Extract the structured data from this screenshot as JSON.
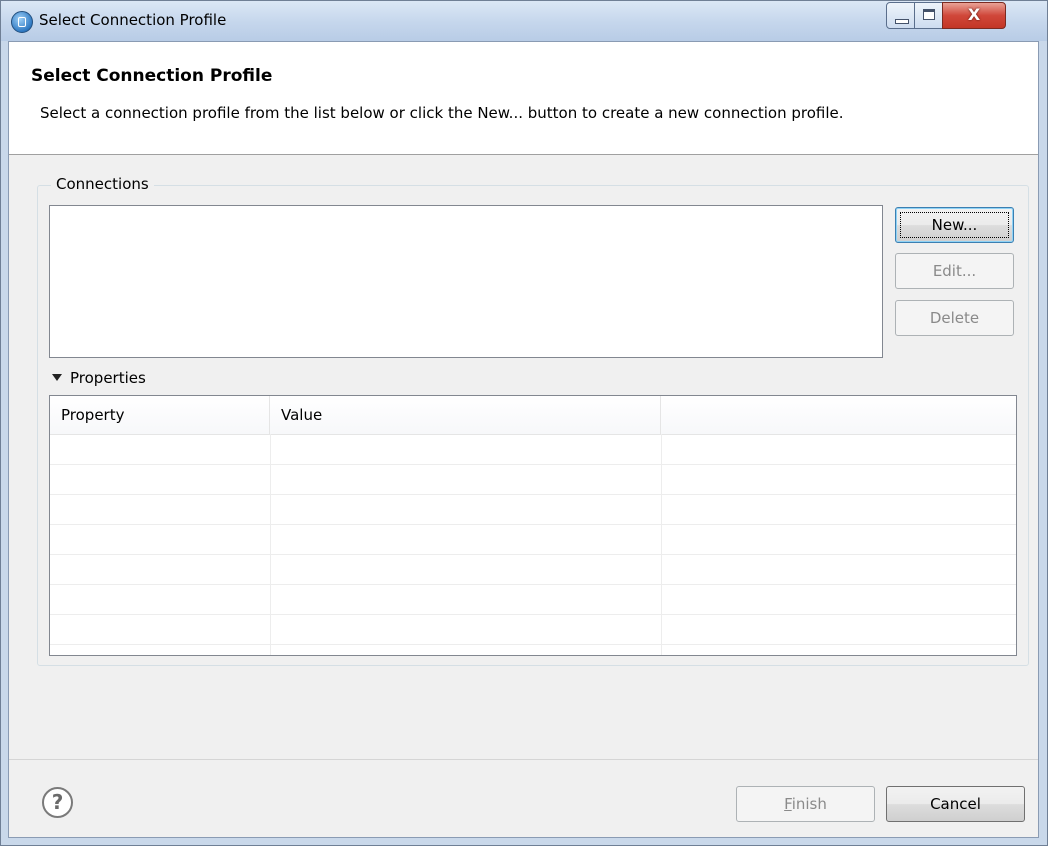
{
  "window": {
    "title": "Select Connection Profile",
    "controls": {
      "minimize": "minimize",
      "maximize": "maximize",
      "close": "X"
    }
  },
  "header": {
    "title": "Select Connection Profile",
    "description": "Select a connection profile from the list below or click the New... button to create a new connection profile."
  },
  "connections": {
    "group_label": "Connections",
    "items": [],
    "buttons": {
      "new": "New...",
      "edit": "Edit...",
      "delete": "Delete"
    }
  },
  "properties": {
    "toggle_label": "Properties",
    "expanded": true,
    "columns": [
      "Property",
      "Value",
      ""
    ],
    "rows": []
  },
  "footer": {
    "help_symbol": "?",
    "finish_mnemonic": "F",
    "finish_rest": "inish",
    "cancel": "Cancel"
  },
  "colors": {
    "titlebar": "#c5d6ec",
    "close_button": "#c33626",
    "dialog_bg": "#f0f0f0"
  }
}
